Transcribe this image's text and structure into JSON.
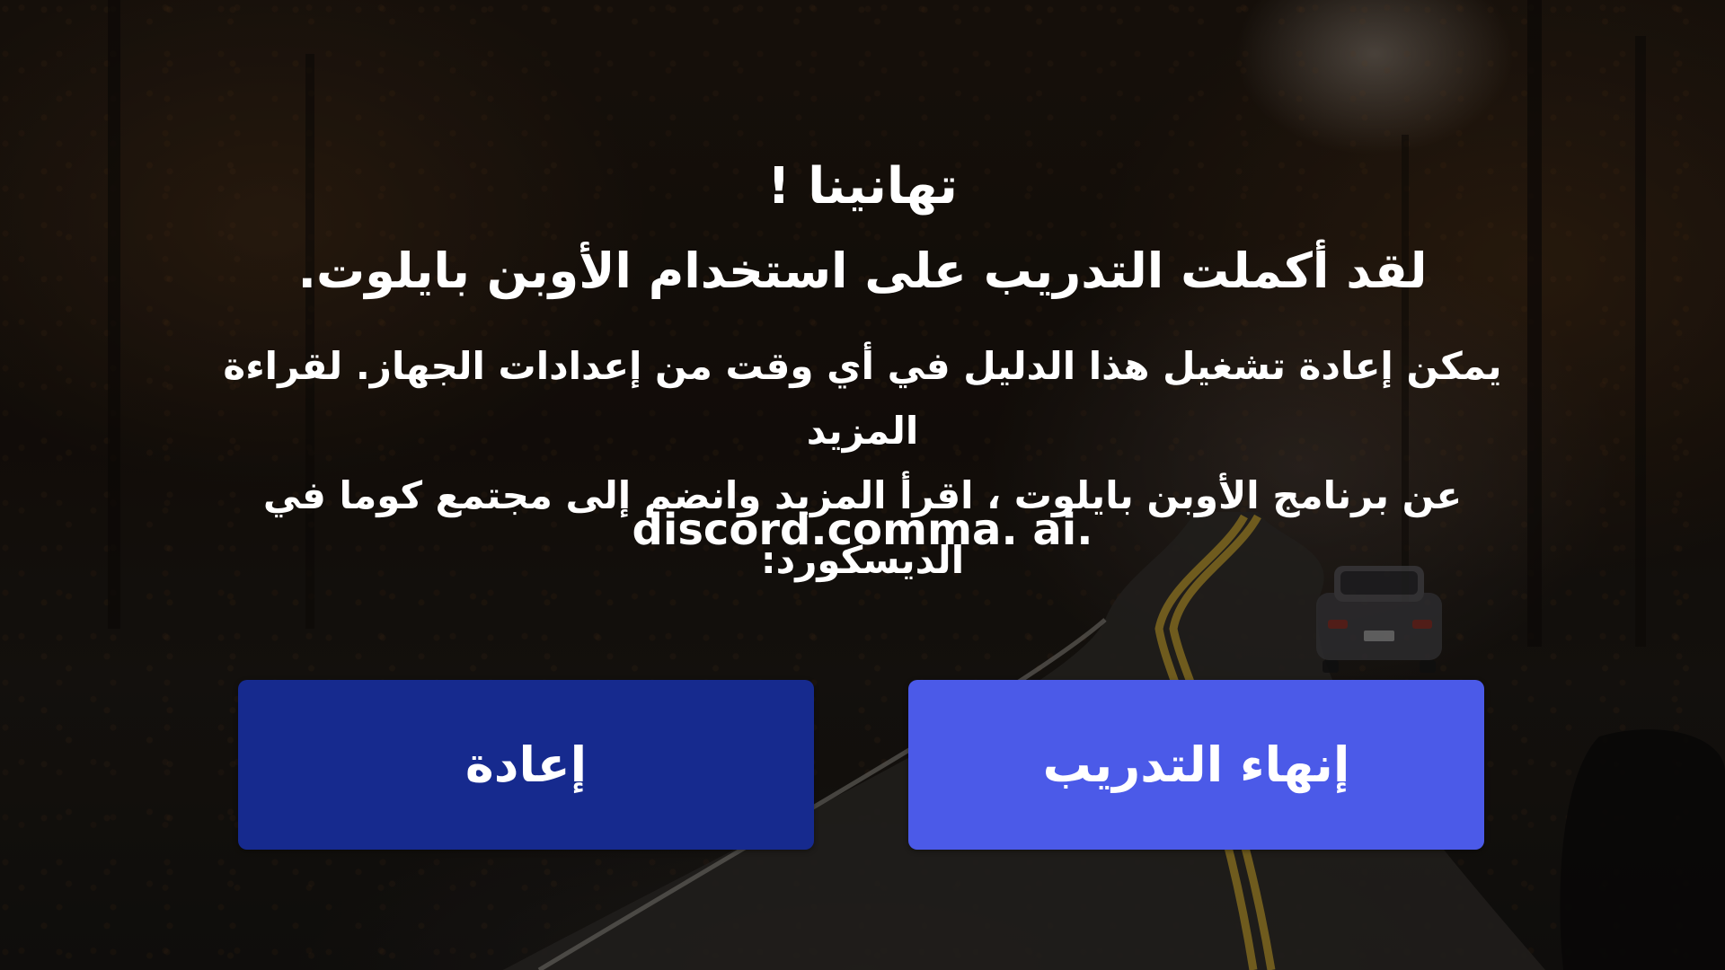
{
  "onboarding_complete": {
    "title": "تهانينا !",
    "subtitle": "لقد أكملت التدريب على استخدام الأوبن بايلوت.",
    "body_line_1": "يمكن إعادة تشغيل هذا الدليل في أي وقت من إعدادات الجهاز. لقراءة المزيد",
    "body_line_2": "عن برنامج الأوبن بايلوت ، اقرأ المزيد وانضم إلى مجتمع كوما في الديسكورد:",
    "link": "discord.comma. ai."
  },
  "buttons": {
    "restart_label": "إعادة",
    "finish_label": "إنهاء التدريب"
  },
  "colors": {
    "restart_button": "#162a8e",
    "finish_button": "#4b5ae8",
    "text": "#ffffff"
  }
}
